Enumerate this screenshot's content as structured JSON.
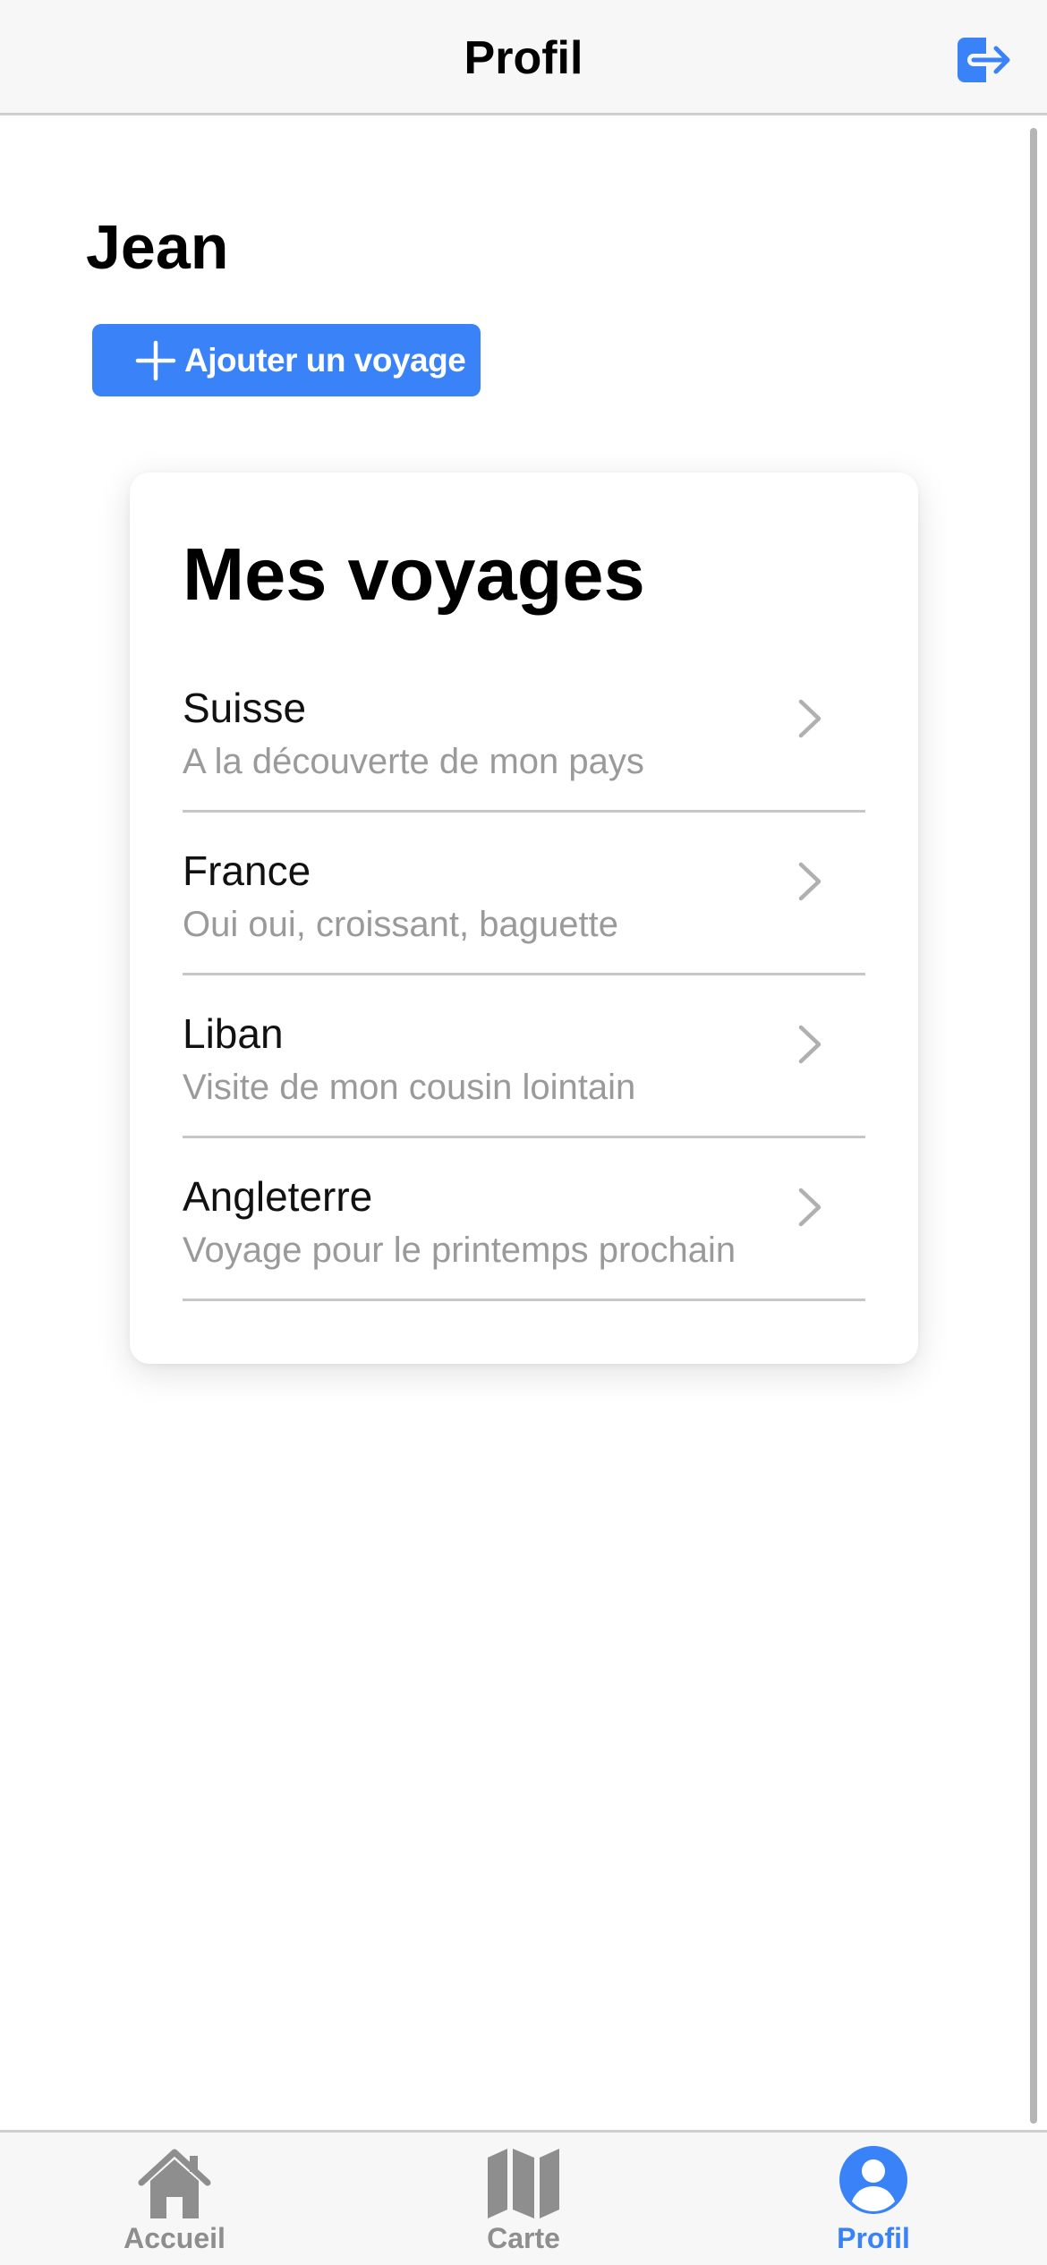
{
  "header": {
    "title": "Profil",
    "logout_icon": "logout-icon"
  },
  "profile": {
    "name": "Jean",
    "add_trip_label": "Ajouter un voyage"
  },
  "card": {
    "title": "Mes voyages",
    "trips": [
      {
        "name": "Suisse",
        "description": "A la découverte de mon pays"
      },
      {
        "name": "France",
        "description": "Oui oui, croissant, baguette"
      },
      {
        "name": "Liban",
        "description": "Visite de mon cousin lointain"
      },
      {
        "name": "Angleterre",
        "description": "Voyage pour le printemps prochain"
      }
    ]
  },
  "tabs": [
    {
      "label": "Accueil",
      "icon": "home-icon",
      "active": false
    },
    {
      "label": "Carte",
      "icon": "map-icon",
      "active": false
    },
    {
      "label": "Profil",
      "icon": "user-circle-icon",
      "active": true
    }
  ],
  "colors": {
    "accent": "#3a82f7",
    "inactive": "#8e8e8e",
    "secondary_text": "#9a9a9a"
  }
}
